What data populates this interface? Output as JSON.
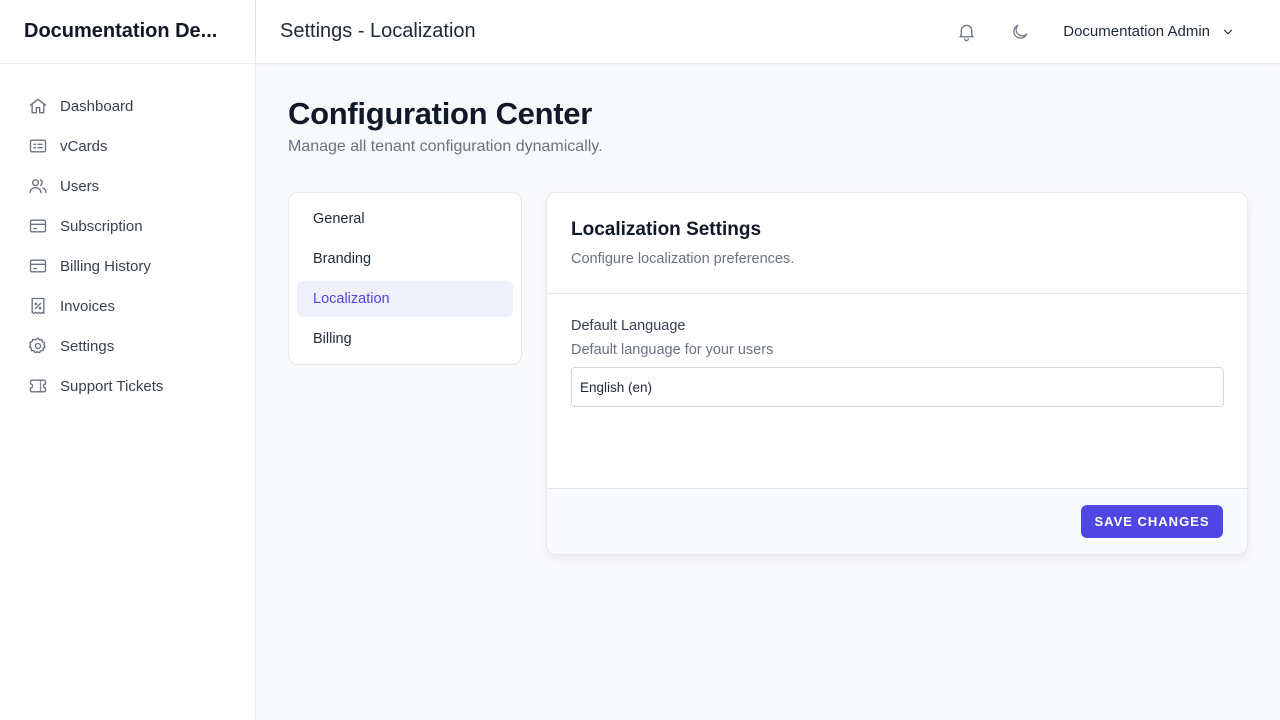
{
  "app": {
    "title": "Documentation De..."
  },
  "sidebar": {
    "items": [
      {
        "label": "Dashboard",
        "icon": "home-icon"
      },
      {
        "label": "vCards",
        "icon": "id-card-icon"
      },
      {
        "label": "Users",
        "icon": "users-icon"
      },
      {
        "label": "Subscription",
        "icon": "credit-card-icon"
      },
      {
        "label": "Billing History",
        "icon": "credit-card-icon"
      },
      {
        "label": "Invoices",
        "icon": "receipt-percent-icon"
      },
      {
        "label": "Settings",
        "icon": "gear-icon"
      },
      {
        "label": "Support Tickets",
        "icon": "ticket-icon"
      }
    ]
  },
  "header": {
    "title": "Settings - Localization",
    "user_name": "Documentation Admin"
  },
  "main": {
    "title": "Configuration Center",
    "subtitle": "Manage all tenant configuration dynamically.",
    "tabs": [
      {
        "label": "General",
        "active": false
      },
      {
        "label": "Branding",
        "active": false
      },
      {
        "label": "Localization",
        "active": true
      },
      {
        "label": "Billing",
        "active": false
      }
    ],
    "panel": {
      "title": "Localization Settings",
      "description": "Configure localization preferences.",
      "field": {
        "label": "Default Language",
        "help": "Default language for your users",
        "value": "English (en)"
      },
      "save_label": "SAVE CHANGES"
    }
  },
  "colors": {
    "accent": "#4f46e5",
    "active_tab_bg": "#eef1fc"
  }
}
